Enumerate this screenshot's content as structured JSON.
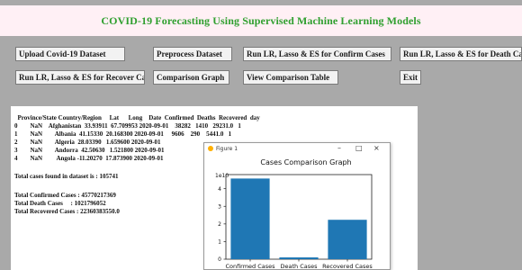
{
  "app": {
    "title": "COVID-19 Forecasting Using Supervised Machine Learning Models",
    "buttons": {
      "upload": "Upload Covid-19 Dataset",
      "preprocess": "Preprocess Dataset",
      "run_confirm": "Run LR, Lasso & ES for Confirm Cases",
      "run_death": "Run LR, Lasso & ES for Death Cases",
      "run_recover": "Run LR, Lasso & ES for Recover Cases",
      "comparison_graph": "Comparison Graph",
      "view_table": "View Comparison Table",
      "exit": "Exit"
    }
  },
  "console": {
    "header": "  Province/State Country/Region     Lat      Long    Date  Confirmed  Deaths  Recovered  day",
    "rows": [
      "0        NaN    Afghanistan  33.93911  67.709953 2020-09-01    38282   1410   29231.0   1",
      "1        NaN        Albania  41.15330  20.168300 2020-09-01     9606    290    5441.0   1",
      "2        NaN        Algeria  28.03390   1.659600 2020-09-01",
      "3        NaN        Andorra  42.50630   1.521800 2020-09-01",
      "4        NaN         Angola -11.20270  17.873900 2020-09-01"
    ],
    "total_found": "Total cases found in dataset is : 105741",
    "total_confirmed": "Total Confirmed Cases : 45770217369",
    "total_death": "Total Death Cases     : 1021796052",
    "total_recovered": "Total Recovered Cases : 22360383550.0"
  },
  "figure": {
    "window_title": "Figure 1",
    "minimize_glyph": "–",
    "maximize_glyph": "□",
    "close_glyph": "×",
    "offset_text": "1e10"
  },
  "chart_data": {
    "type": "bar",
    "title": "Cases Comparison Graph",
    "categories": [
      "Confirmed Cases",
      "Death Cases",
      "Recovered Cases"
    ],
    "values": [
      45770217369,
      1021796052,
      22360383550
    ],
    "ylim": [
      0,
      48000000000
    ],
    "yticks": [
      0,
      1,
      2,
      3,
      4
    ],
    "ytick_scale": 10000000000,
    "bar_color": "#1f77b4",
    "grid": false
  }
}
